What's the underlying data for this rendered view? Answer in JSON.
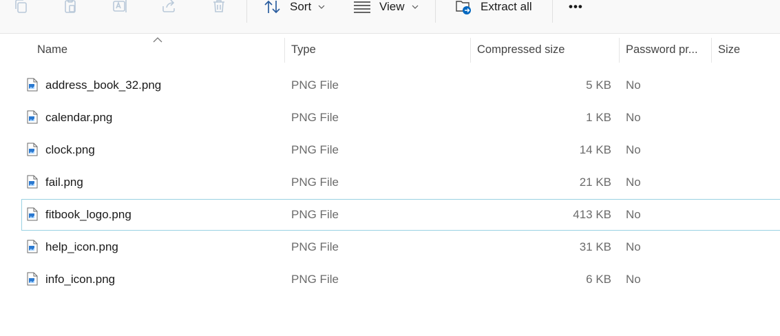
{
  "toolbar": {
    "disabled_icons": [
      "copy-icon",
      "paste-icon",
      "rename-icon",
      "share-icon",
      "delete-icon"
    ],
    "sort_label": "Sort",
    "view_label": "View",
    "extract_label": "Extract all",
    "more_label": "•••"
  },
  "columns": {
    "name": "Name",
    "type": "Type",
    "compressed_size": "Compressed size",
    "password": "Password pr...",
    "size": "Size"
  },
  "files": [
    {
      "name": "address_book_32.png",
      "type": "PNG File",
      "compressed_size": "5 KB",
      "password": "No"
    },
    {
      "name": "calendar.png",
      "type": "PNG File",
      "compressed_size": "1 KB",
      "password": "No"
    },
    {
      "name": "clock.png",
      "type": "PNG File",
      "compressed_size": "14 KB",
      "password": "No"
    },
    {
      "name": "fail.png",
      "type": "PNG File",
      "compressed_size": "21 KB",
      "password": "No"
    },
    {
      "name": "fitbook_logo.png",
      "type": "PNG File",
      "compressed_size": "413 KB",
      "password": "No"
    },
    {
      "name": "help_icon.png",
      "type": "PNG File",
      "compressed_size": "31 KB",
      "password": "No"
    },
    {
      "name": "info_icon.png",
      "type": "PNG File",
      "compressed_size": "6 KB",
      "password": "No"
    }
  ],
  "colors": {
    "accent": "#0067c0",
    "focus_border": "#99d1e2",
    "disabled_icon": "#b9c9d9"
  }
}
